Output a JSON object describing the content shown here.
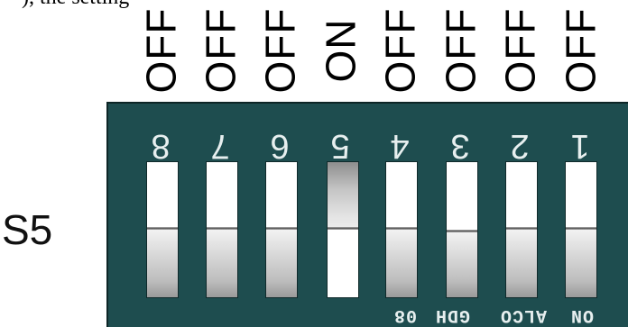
{
  "partial_text": "), the setting",
  "switch_label": "S5",
  "switches": [
    {
      "number": "8",
      "state": "OFF"
    },
    {
      "number": "7",
      "state": "OFF"
    },
    {
      "number": "6",
      "state": "OFF"
    },
    {
      "number": "5",
      "state": "ON"
    },
    {
      "number": "4",
      "state": "OFF"
    },
    {
      "number": "3",
      "state": "OFF"
    },
    {
      "number": "2",
      "state": "OFF"
    },
    {
      "number": "1",
      "state": "OFF"
    }
  ],
  "footer_labels": [
    "08",
    "GDH",
    "ALCO",
    "ON"
  ],
  "colors": {
    "board": "#1e4d4f",
    "text_on_board": "#e7efef"
  }
}
